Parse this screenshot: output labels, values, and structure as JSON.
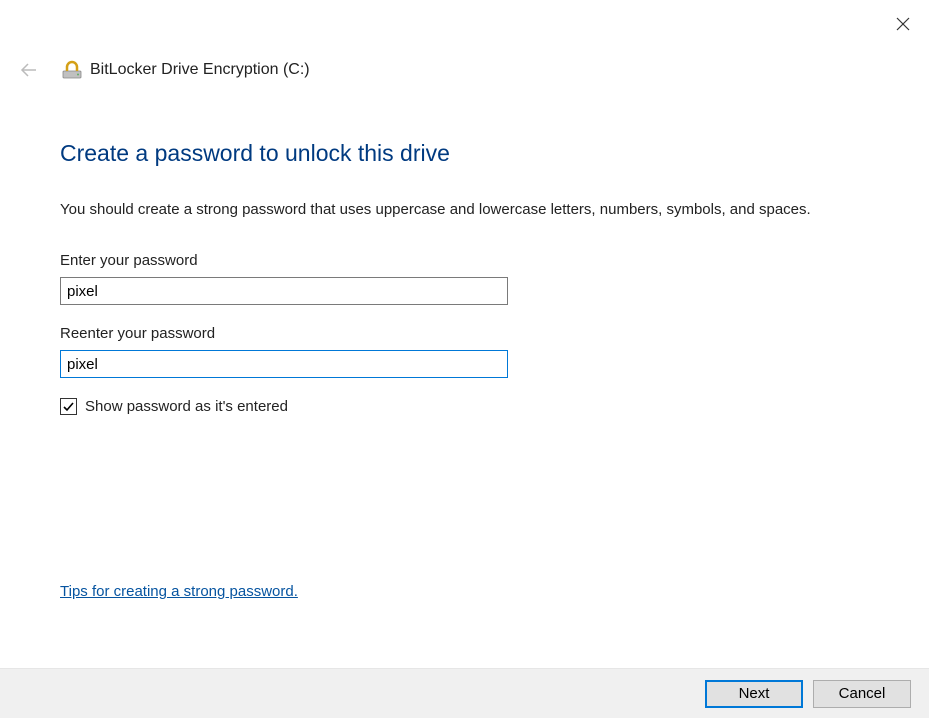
{
  "window": {
    "title": "BitLocker Drive Encryption (C:)"
  },
  "page": {
    "heading": "Create a password to unlock this drive",
    "instructions": "You should create a strong password that uses uppercase and lowercase letters, numbers, symbols, and spaces."
  },
  "fields": {
    "enter_label": "Enter your password",
    "enter_value": "pixel",
    "reenter_label": "Reenter your password",
    "reenter_value": "pixel"
  },
  "checkbox": {
    "label": "Show password as it's entered",
    "checked": true
  },
  "link": {
    "tips": "Tips for creating a strong password."
  },
  "footer": {
    "next": "Next",
    "cancel": "Cancel"
  }
}
